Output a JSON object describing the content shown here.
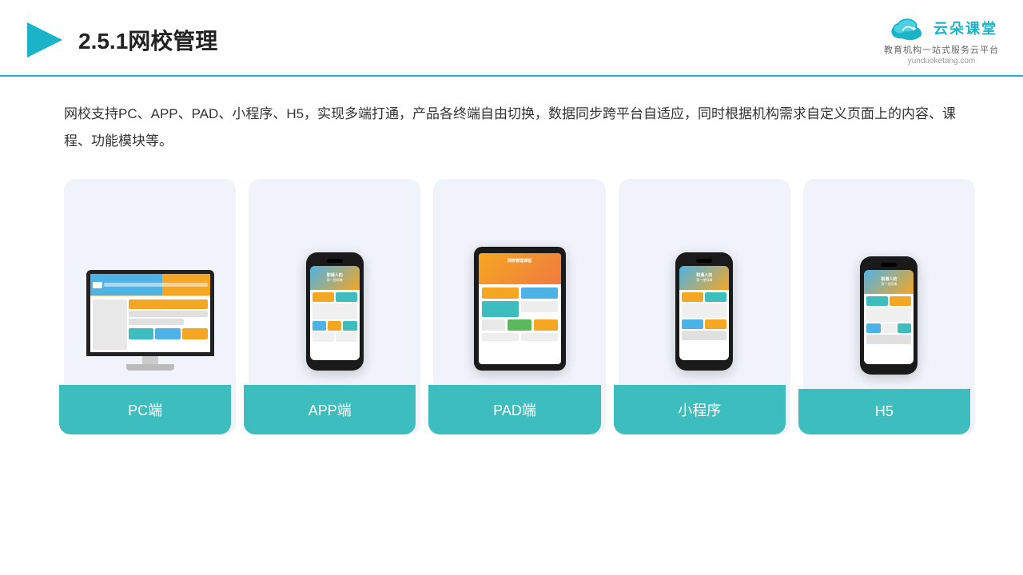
{
  "header": {
    "section_number": "2.5.1",
    "title": "网校管理",
    "logo_name": "云朵课堂",
    "logo_url": "yunduoketang.com",
    "logo_tagline": "教育机构一站式服务云平台"
  },
  "description": {
    "text": "网校支持PC、APP、PAD、小程序、H5，实现多端打通，产品各终端自由切换，数据同步跨平台自适应，同时根据机构需求自定义页面上的内容、课程、功能模块等。"
  },
  "cards": [
    {
      "id": "pc",
      "label": "PC端"
    },
    {
      "id": "app",
      "label": "APP端"
    },
    {
      "id": "pad",
      "label": "PAD端"
    },
    {
      "id": "miniapp",
      "label": "小程序"
    },
    {
      "id": "h5",
      "label": "H5"
    }
  ]
}
